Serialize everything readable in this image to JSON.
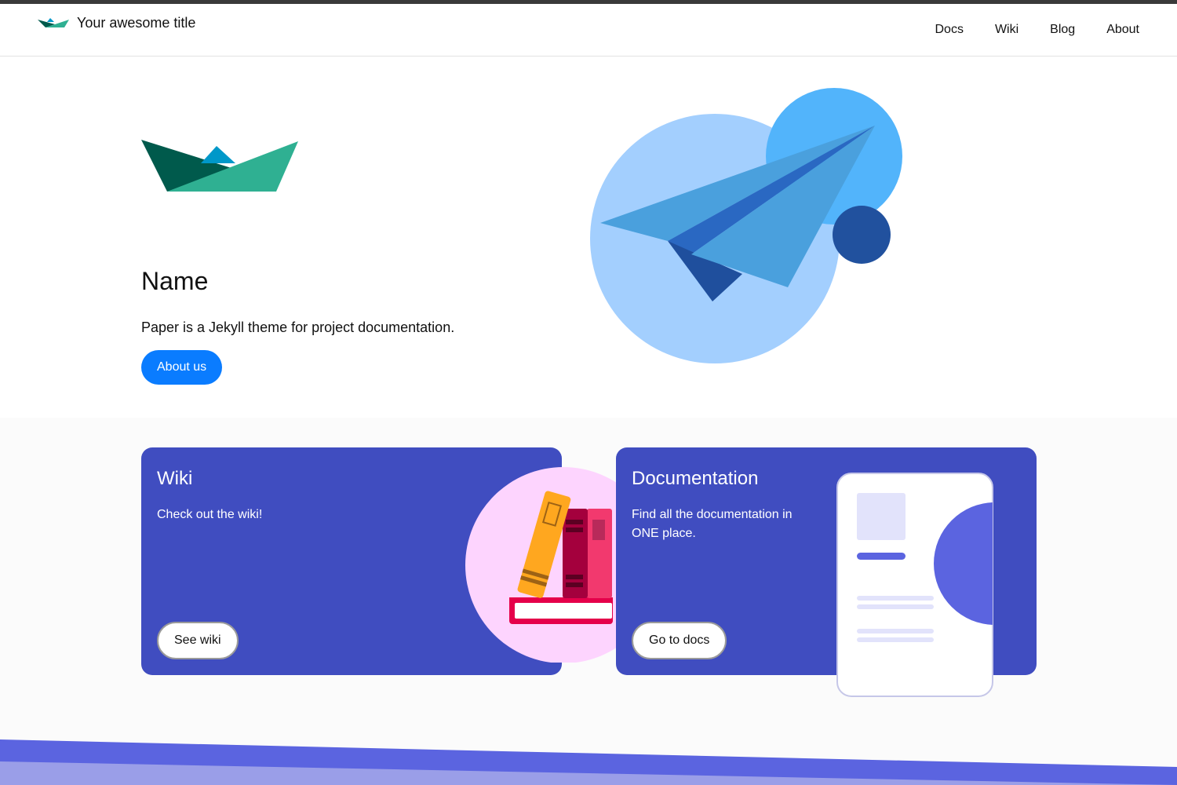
{
  "navbar": {
    "brand_title": "Your awesome title",
    "links": [
      {
        "label": "Docs"
      },
      {
        "label": "Wiki"
      },
      {
        "label": "Blog"
      },
      {
        "label": "About"
      }
    ]
  },
  "hero": {
    "title": "Name",
    "description": "Paper is a Jekyll theme for project documentation.",
    "button_label": "About us"
  },
  "cards": {
    "wiki": {
      "title": "Wiki",
      "description": "Check out the wiki!",
      "button_label": "See wiki"
    },
    "docs": {
      "title": "Documentation",
      "description": "Find all the documentation in ONE place.",
      "button_label": "Go to docs"
    }
  },
  "icons": {
    "brand": "paper-boat-icon",
    "hero_logo": "paper-boat-logo",
    "hero_illustration": "paper-plane-illustration",
    "wiki_illustration": "books-illustration",
    "docs_illustration": "document-page-illustration"
  },
  "colors": {
    "accent_button": "#0a7cff",
    "card_background": "#404dc0",
    "boat_dark": "#005a4c",
    "boat_teal": "#2fb092",
    "boat_cyan": "#0098c9",
    "footer_band": "#5b64e0"
  }
}
